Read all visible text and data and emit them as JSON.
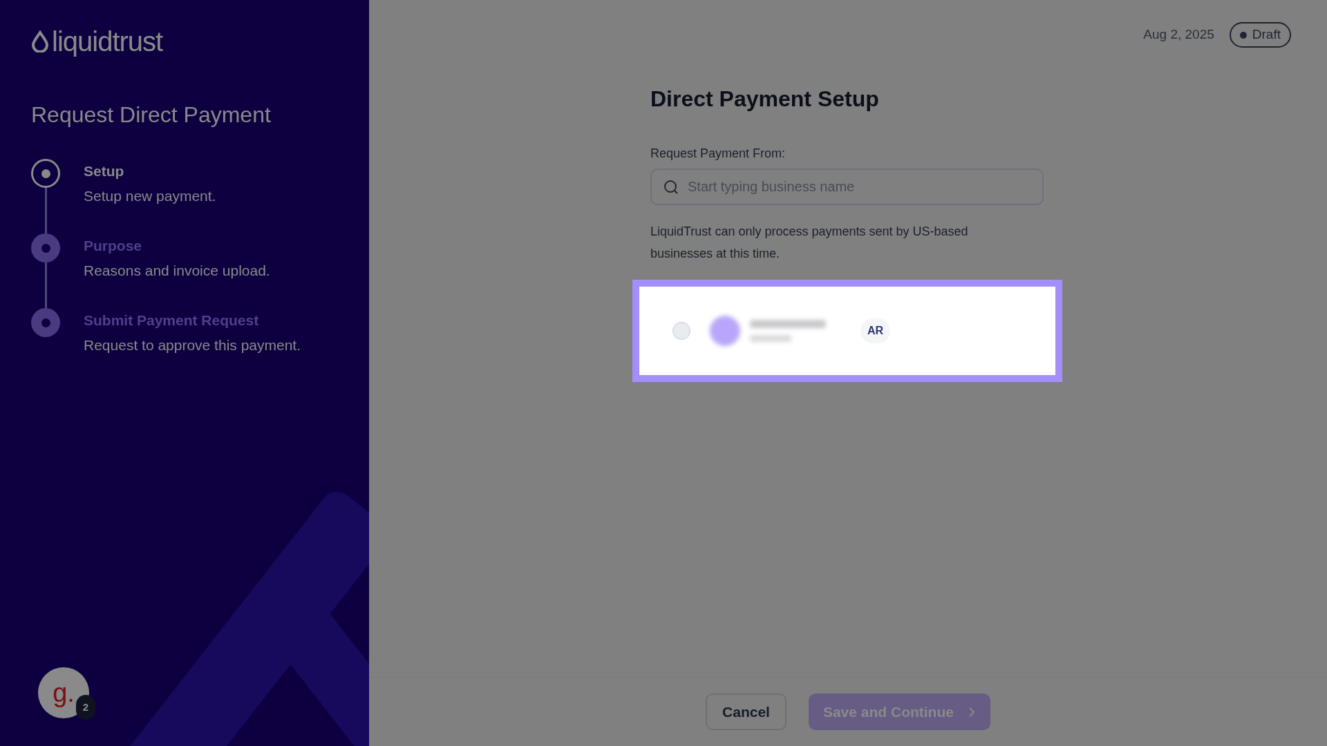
{
  "sidebar": {
    "logo": "liquidtrust",
    "title": "Request Direct Payment",
    "steps": [
      {
        "title": "Setup",
        "subtitle": "Setup new payment.",
        "selected": true
      },
      {
        "title": "Purpose",
        "subtitle": "Reasons and invoice upload.",
        "selected": false
      },
      {
        "title": "Submit Payment Request",
        "subtitle": "Request to approve this payment.",
        "selected": false
      }
    ],
    "user_avatar": {
      "initial": "g.",
      "badge": "2"
    }
  },
  "header": {
    "date": "Aug 2, 2025",
    "status": "Draft"
  },
  "form": {
    "title": "Direct Payment Setup",
    "field": {
      "label": "Request Payment From:",
      "placeholder": "Start typing business name"
    },
    "note": "LiquidTrust can only process payments sent by US-based businesses at this time.",
    "results": [
      {
        "selected": false,
        "tag": "AR"
      }
    ]
  },
  "footer": {
    "buttons": [
      {
        "label": "Cancel",
        "kind": "secondary"
      },
      {
        "label": "Save and Continue",
        "kind": "primary"
      }
    ]
  }
}
